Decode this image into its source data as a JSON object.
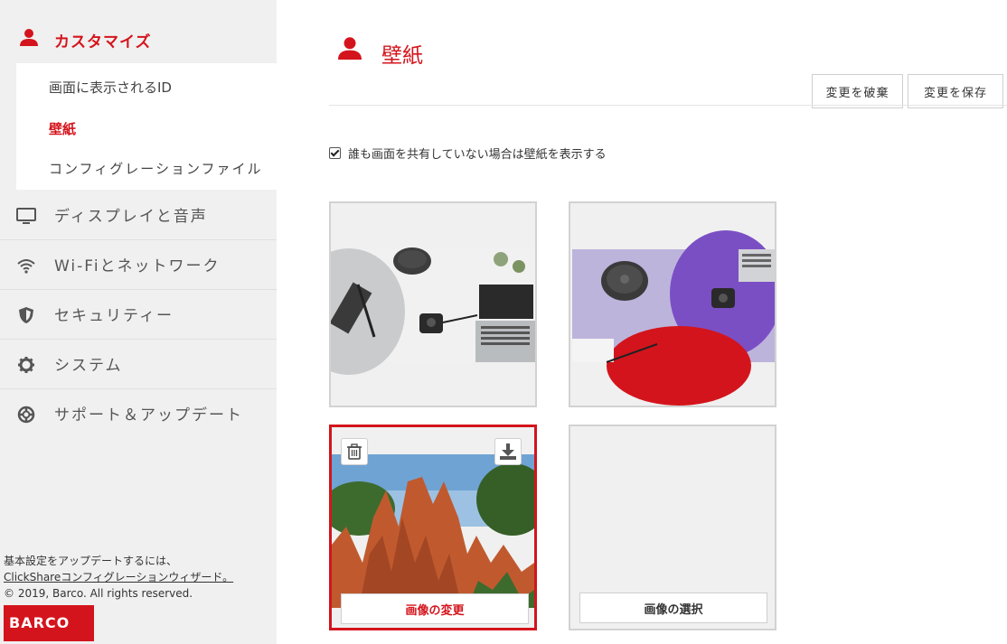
{
  "sidebar": {
    "header": "カスタマイズ",
    "submenu": [
      "画面に表示されるID",
      "壁紙",
      "コンフィグレーションファイル"
    ],
    "items": [
      {
        "label": "ディスプレイと音声",
        "icon": "monitor-icon"
      },
      {
        "label": "Wi-Fiとネットワーク",
        "icon": "wifi-icon"
      },
      {
        "label": "セキュリティー",
        "icon": "shield-icon"
      },
      {
        "label": "システム",
        "icon": "gear-icon"
      },
      {
        "label": "サポート＆アップデート",
        "icon": "lifebuoy-icon"
      }
    ],
    "footer": {
      "line1": "基本設定をアップデートするには、",
      "line2": "ClickShareコンフィグレーションウィザード。",
      "line3": "© 2019, Barco. All rights reserved."
    },
    "logo": "BARCO"
  },
  "main": {
    "title": "壁紙",
    "discard_label": "変更を破棄",
    "save_label": "変更を保存",
    "checkbox_label": "誰も画面を共有していない場合は壁紙を表示する",
    "checkbox_checked": true,
    "change_image_label": "画像の変更",
    "select_image_label": "画像の選択"
  },
  "colors": {
    "accent": "#d4141c",
    "sidebar_bg": "#f0f0f0"
  }
}
